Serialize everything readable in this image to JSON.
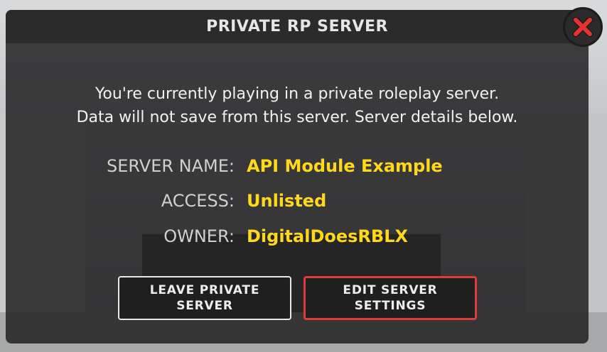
{
  "dialog": {
    "title": "PRIVATE RP SERVER",
    "description_line1": "You're currently playing in a private roleplay server.",
    "description_line2": "Data will not save from this server. Server details below."
  },
  "details": [
    {
      "label": "SERVER NAME:",
      "value": "API Module Example"
    },
    {
      "label": "ACCESS:",
      "value": "Unlisted"
    },
    {
      "label": "OWNER:",
      "value": "DigitalDoesRBLX"
    }
  ],
  "buttons": {
    "leave_line1": "LEAVE PRIVATE",
    "leave_line2": "SERVER",
    "edit_line1": "EDIT SERVER",
    "edit_line2": "SETTINGS"
  },
  "colors": {
    "value_text": "#ffd81a",
    "close_icon": "#e8322f",
    "edit_border": "#e03b3b"
  },
  "icons": {
    "close": "close-x-icon"
  }
}
